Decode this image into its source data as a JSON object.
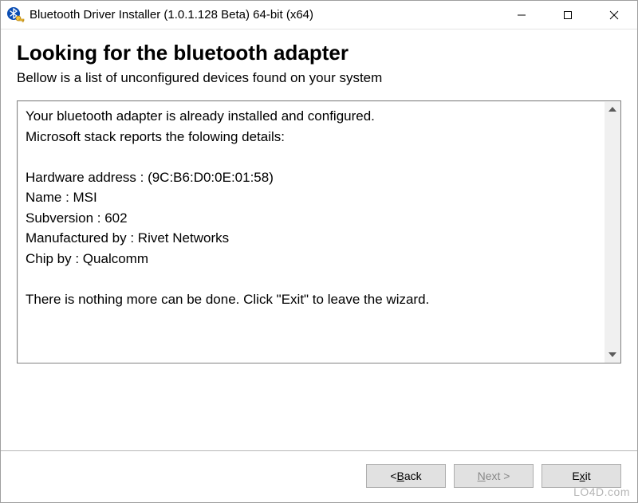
{
  "window": {
    "title": "Bluetooth Driver Installer (1.0.1.128 Beta) 64-bit (x64)"
  },
  "header": {
    "heading": "Looking for the bluetooth adapter",
    "subheading": "Bellow is a list of unconfigured devices found on your system"
  },
  "details": {
    "line_installed": "Your bluetooth adapter is already installed and configured.",
    "line_stack": "Microsoft stack reports the folowing details:",
    "hardware_address_label": "Hardware address",
    "hardware_address_value": "(9C:B6:D0:0E:01:58)",
    "name_label": "Name",
    "name_value": "MSI",
    "subversion_label": "Subversion",
    "subversion_value": "602",
    "manufactured_by_label": "Manufactured by",
    "manufactured_by_value": "Rivet Networks",
    "chip_by_label": "Chip by",
    "chip_by_value": "Qualcomm",
    "line_nothing": "There is nothing more can be done. Click \"Exit\" to leave the wizard."
  },
  "buttons": {
    "back_prefix": "< ",
    "back_accel": "B",
    "back_rest": "ack",
    "next_accel": "N",
    "next_rest": "ext >",
    "exit_prefix": "E",
    "exit_accel": "x",
    "exit_rest": "it"
  },
  "watermark": "LO4D.com"
}
